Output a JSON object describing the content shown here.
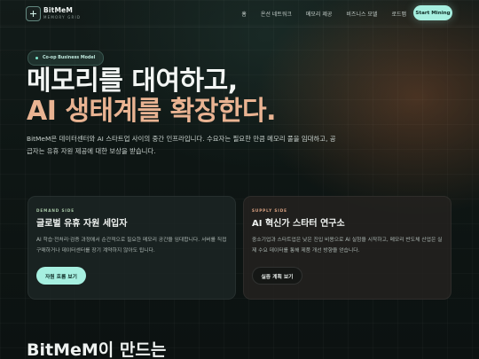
{
  "nav": {
    "brand_name": "BitMeM",
    "brand_sub": "MEMORY GRID",
    "links": [
      "홈",
      "온선 네트워크",
      "메모리 제공",
      "비즈니스 모델",
      "로드맵"
    ],
    "cta_label": "Start Mining"
  },
  "hero": {
    "badge": "Co-op Business Model",
    "headline_line1": "메모리를 대여하고,",
    "headline_line2": "AI 생태계를 확장한다.",
    "description": "BitMeM은 데이터센터와 AI 스타트업 사이의 중간 인프라입니다. 수요자는 필요한 만큼 메모리 풀을 임대하고, 공급자는 유휴 자원 제공에 대한 보상을 받습니다."
  },
  "cards": [
    {
      "tag": "DEMAND SIDE",
      "title": "글로벌 유휴 자원 세입자",
      "description": "AI 학습·전처리·검증 과정에서 순간적으로 필요한 메모리 공간을 임대합니다. 서버를 직접 구매하거나 데이터센터를 장기 계약하지 않아도 됩니다.",
      "button_label": "자원 흐름 보기"
    },
    {
      "tag": "SUPPLY SIDE",
      "title": "AI 혁신가 스타터 연구소",
      "description": "중소기업과 스타트업은 낮은 진입 비용으로 AI 실험을 시작하고, 메모리 반도체 산업은 실제 수요 데이터를 통해 제품 개선 방향을 얻습니다.",
      "button_label": "실증 계획 보기"
    }
  ],
  "section": {
    "heading": "BitMeM이 만드는"
  },
  "colors": {
    "accent_mint": "#a6efe0",
    "accent_peach": "#e9b392",
    "background": "#0d1413"
  },
  "icons": {
    "logo": "plus-icon",
    "badge": "dot-icon"
  }
}
